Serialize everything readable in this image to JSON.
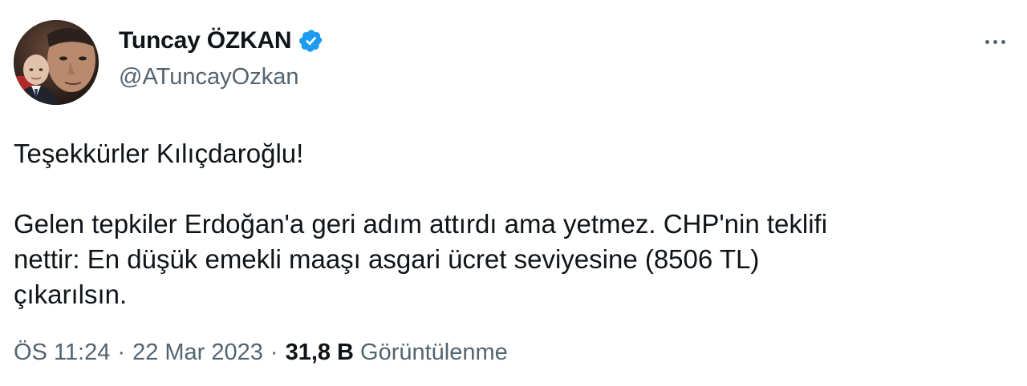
{
  "author": {
    "display_name": "Tuncay ÖZKAN",
    "handle": "@ATuncayOzkan",
    "verified": true,
    "verified_icon": "verified-badge-icon",
    "avatar_icon": "profile-avatar"
  },
  "tweet": {
    "paragraphs": [
      "Teşekkürler Kılıçdaroğlu!",
      "Gelen tepkiler Erdoğan'a geri adım attırdı ama yetmez. CHP'nin teklifi\nnettir: En düşük emekli maaşı asgari ücret seviyesine (8506 TL)\nçıkarılsın."
    ]
  },
  "meta": {
    "time": "ÖS 11:24",
    "separator": "·",
    "date": "22 Mar 2023",
    "views_count": "31,8 B",
    "views_label": "Görüntülenme"
  },
  "menu": {
    "icon": "more-options-icon"
  },
  "colors": {
    "text_primary": "#0f1419",
    "text_secondary": "#536471",
    "verified_blue": "#1d9bf0",
    "background": "#ffffff"
  }
}
